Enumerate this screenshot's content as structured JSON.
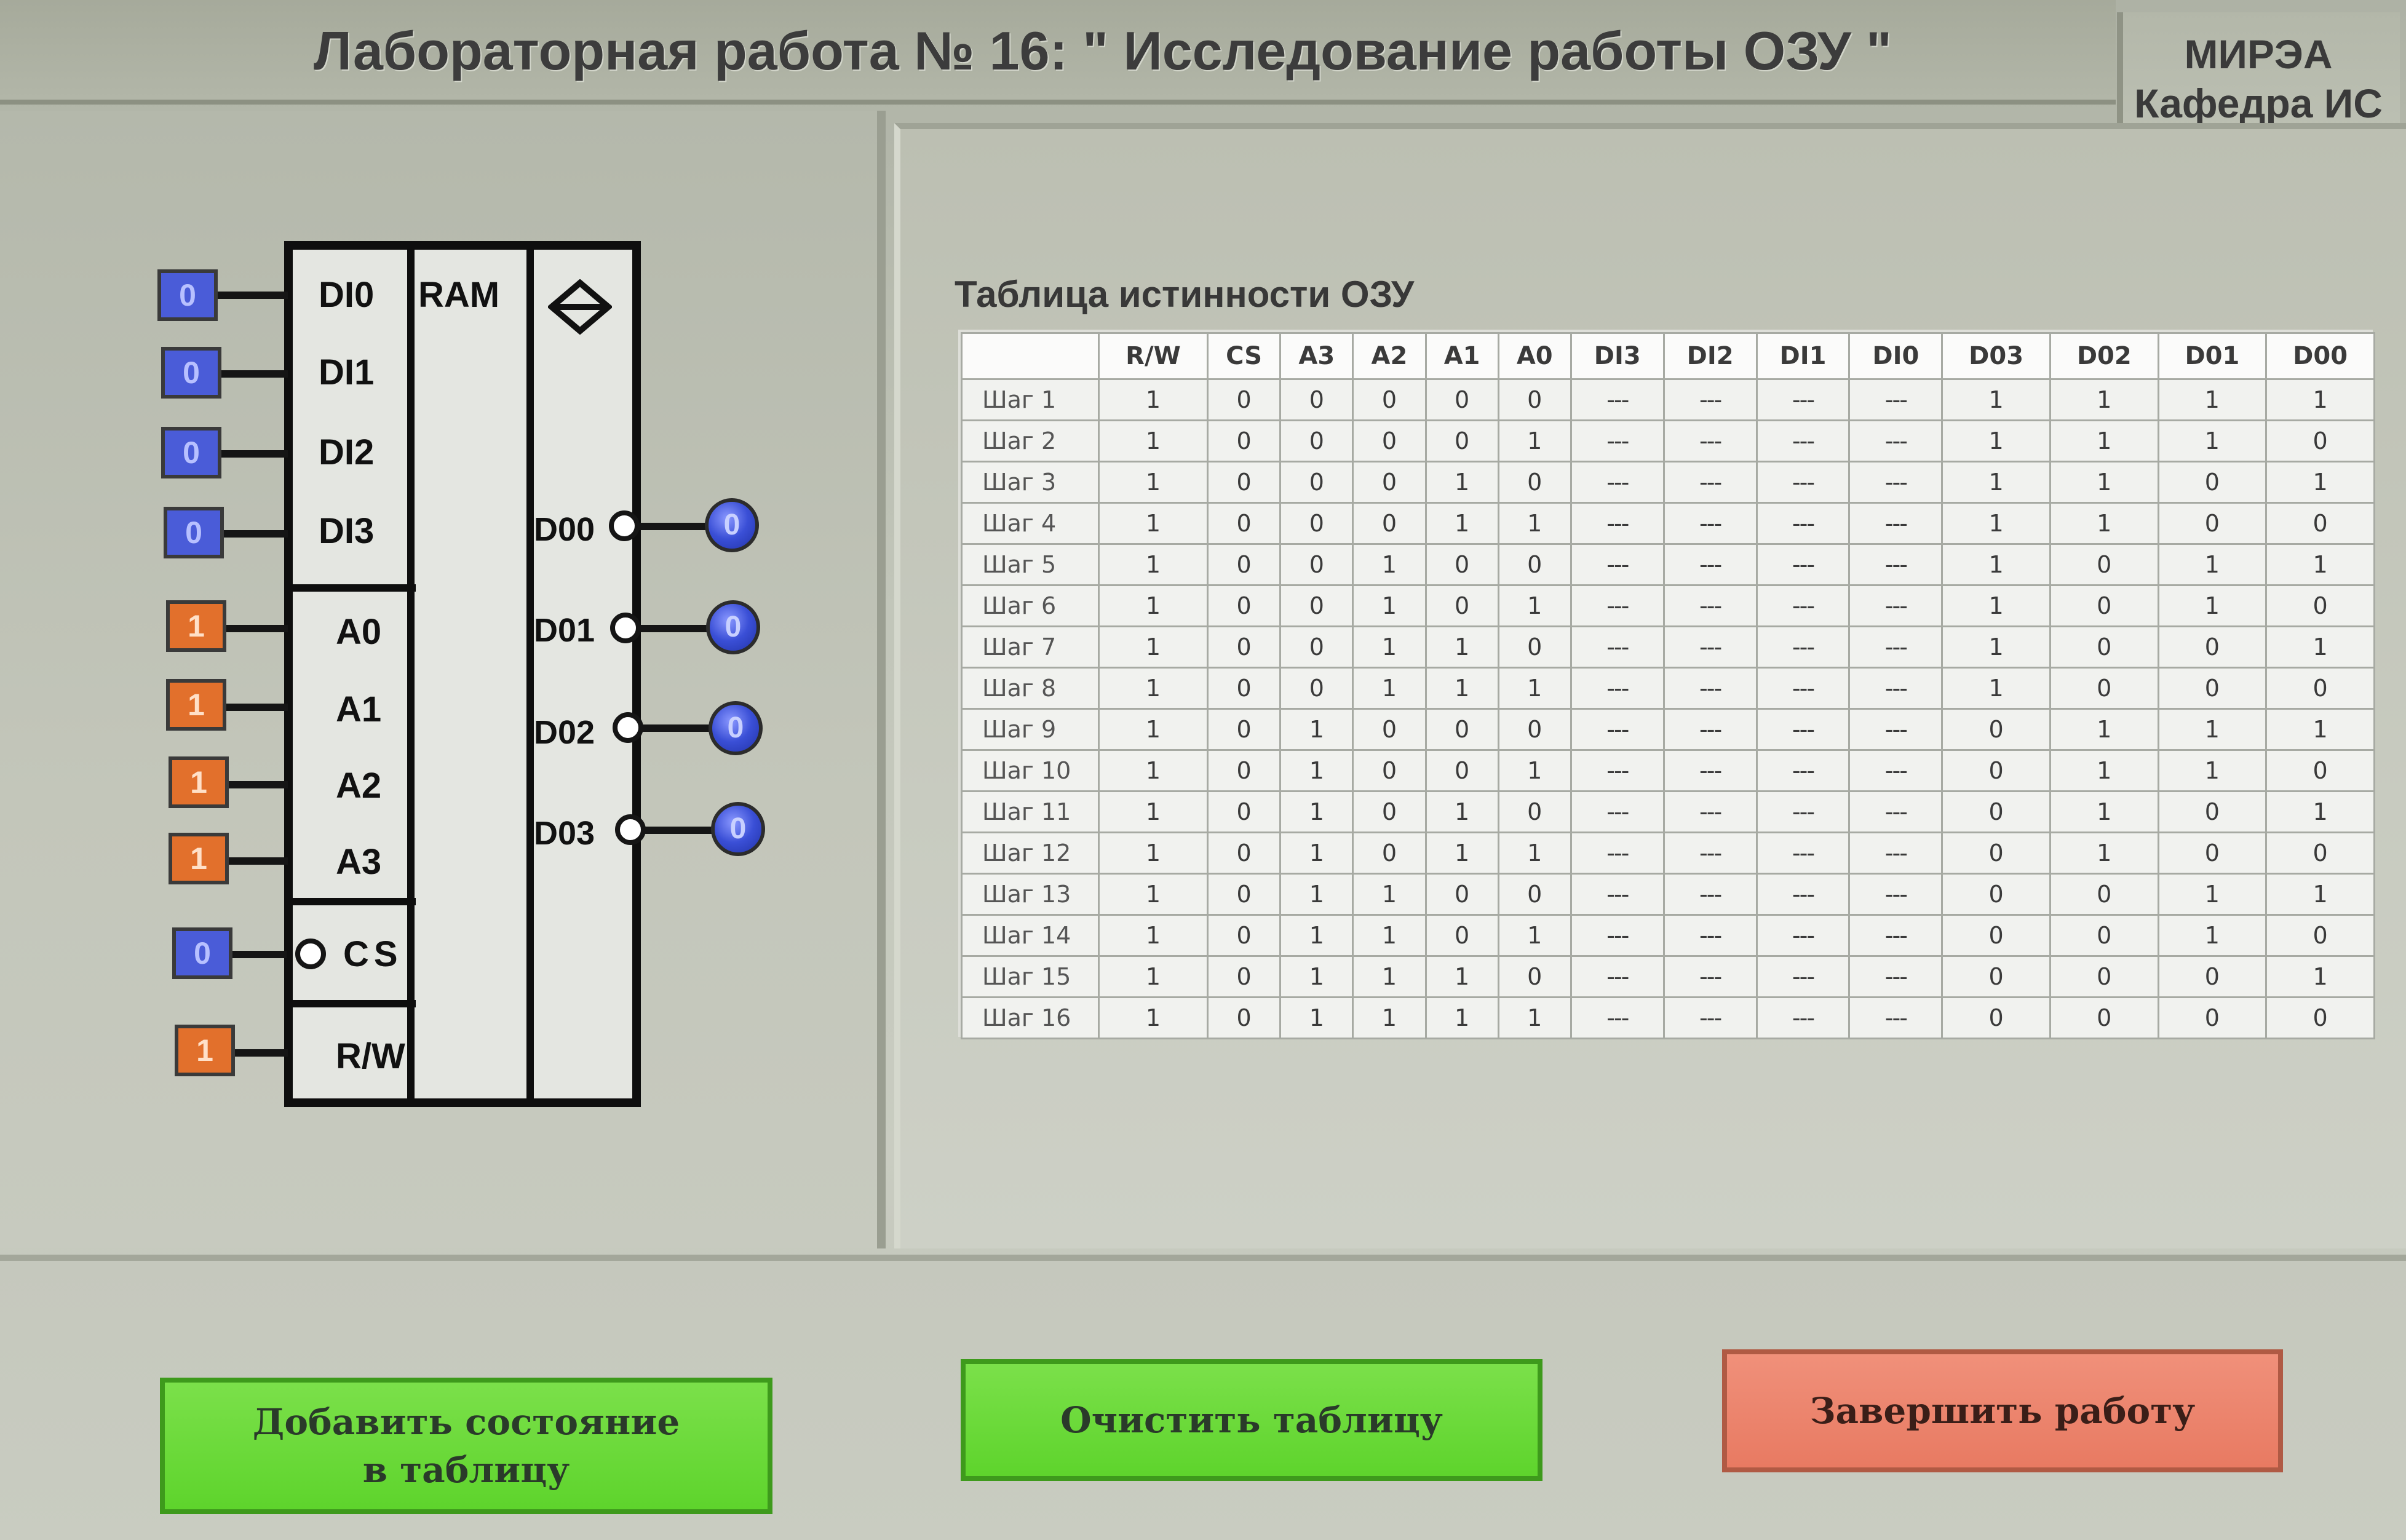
{
  "header": {
    "title": "Лабораторная работа № 16: \" Исследование работы ОЗУ \"",
    "org_line1": "МИРЭА",
    "org_line2": "Кафедра ИС"
  },
  "chip": {
    "title": "RAM",
    "symbol_icon": "bidirectional-diamond-icon",
    "inputs": {
      "DI0": {
        "label": "DI0",
        "value": "0"
      },
      "DI1": {
        "label": "DI1",
        "value": "0"
      },
      "DI2": {
        "label": "DI2",
        "value": "0"
      },
      "DI3": {
        "label": "DI3",
        "value": "0"
      },
      "A0": {
        "label": "A0",
        "value": "1"
      },
      "A1": {
        "label": "A1",
        "value": "1"
      },
      "A2": {
        "label": "A2",
        "value": "1"
      },
      "A3": {
        "label": "A3",
        "value": "1"
      },
      "CS": {
        "label": "CS",
        "value": "0"
      },
      "RW": {
        "label": "R/W",
        "value": "1"
      }
    },
    "outputs": {
      "D00": {
        "label": "D00",
        "value": "0"
      },
      "D01": {
        "label": "D01",
        "value": "0"
      },
      "D02": {
        "label": "D02",
        "value": "0"
      },
      "D03": {
        "label": "D03",
        "value": "0"
      }
    },
    "colors": {
      "data_input": "#4a5cd8",
      "control_input": "#e2702c",
      "output_led": "#3a4fd6"
    }
  },
  "table": {
    "title": "Таблица истинности ОЗУ",
    "columns": [
      "R/W",
      "CS",
      "A3",
      "A2",
      "A1",
      "A0",
      "DI3",
      "DI2",
      "DI1",
      "DI0",
      "D03",
      "D02",
      "D01",
      "D00"
    ],
    "rows": [
      {
        "label": "Шаг 1",
        "cells": [
          "1",
          "0",
          "0",
          "0",
          "0",
          "0",
          "---",
          "---",
          "---",
          "---",
          "1",
          "1",
          "1",
          "1"
        ]
      },
      {
        "label": "Шаг 2",
        "cells": [
          "1",
          "0",
          "0",
          "0",
          "0",
          "1",
          "---",
          "---",
          "---",
          "---",
          "1",
          "1",
          "1",
          "0"
        ]
      },
      {
        "label": "Шаг 3",
        "cells": [
          "1",
          "0",
          "0",
          "0",
          "1",
          "0",
          "---",
          "---",
          "---",
          "---",
          "1",
          "1",
          "0",
          "1"
        ]
      },
      {
        "label": "Шаг 4",
        "cells": [
          "1",
          "0",
          "0",
          "0",
          "1",
          "1",
          "---",
          "---",
          "---",
          "---",
          "1",
          "1",
          "0",
          "0"
        ]
      },
      {
        "label": "Шаг 5",
        "cells": [
          "1",
          "0",
          "0",
          "1",
          "0",
          "0",
          "---",
          "---",
          "---",
          "---",
          "1",
          "0",
          "1",
          "1"
        ]
      },
      {
        "label": "Шаг 6",
        "cells": [
          "1",
          "0",
          "0",
          "1",
          "0",
          "1",
          "---",
          "---",
          "---",
          "---",
          "1",
          "0",
          "1",
          "0"
        ]
      },
      {
        "label": "Шаг 7",
        "cells": [
          "1",
          "0",
          "0",
          "1",
          "1",
          "0",
          "---",
          "---",
          "---",
          "---",
          "1",
          "0",
          "0",
          "1"
        ]
      },
      {
        "label": "Шаг 8",
        "cells": [
          "1",
          "0",
          "0",
          "1",
          "1",
          "1",
          "---",
          "---",
          "---",
          "---",
          "1",
          "0",
          "0",
          "0"
        ]
      },
      {
        "label": "Шаг 9",
        "cells": [
          "1",
          "0",
          "1",
          "0",
          "0",
          "0",
          "---",
          "---",
          "---",
          "---",
          "0",
          "1",
          "1",
          "1"
        ]
      },
      {
        "label": "Шаг 10",
        "cells": [
          "1",
          "0",
          "1",
          "0",
          "0",
          "1",
          "---",
          "---",
          "---",
          "---",
          "0",
          "1",
          "1",
          "0"
        ]
      },
      {
        "label": "Шаг 11",
        "cells": [
          "1",
          "0",
          "1",
          "0",
          "1",
          "0",
          "---",
          "---",
          "---",
          "---",
          "0",
          "1",
          "0",
          "1"
        ]
      },
      {
        "label": "Шаг 12",
        "cells": [
          "1",
          "0",
          "1",
          "0",
          "1",
          "1",
          "---",
          "---",
          "---",
          "---",
          "0",
          "1",
          "0",
          "0"
        ]
      },
      {
        "label": "Шаг 13",
        "cells": [
          "1",
          "0",
          "1",
          "1",
          "0",
          "0",
          "---",
          "---",
          "---",
          "---",
          "0",
          "0",
          "1",
          "1"
        ]
      },
      {
        "label": "Шаг 14",
        "cells": [
          "1",
          "0",
          "1",
          "1",
          "0",
          "1",
          "---",
          "---",
          "---",
          "---",
          "0",
          "0",
          "1",
          "0"
        ]
      },
      {
        "label": "Шаг 15",
        "cells": [
          "1",
          "0",
          "1",
          "1",
          "1",
          "0",
          "---",
          "---",
          "---",
          "---",
          "0",
          "0",
          "0",
          "1"
        ]
      },
      {
        "label": "Шаг 16",
        "cells": [
          "1",
          "0",
          "1",
          "1",
          "1",
          "1",
          "---",
          "---",
          "---",
          "---",
          "0",
          "0",
          "0",
          "0"
        ]
      }
    ]
  },
  "buttons": {
    "add_state": "Добавить состояние\nв таблицу",
    "clear_table": "Очистить таблицу",
    "finish": "Завершить работу",
    "colors": {
      "green": "#5ed42c",
      "red": "#e87a62"
    }
  }
}
